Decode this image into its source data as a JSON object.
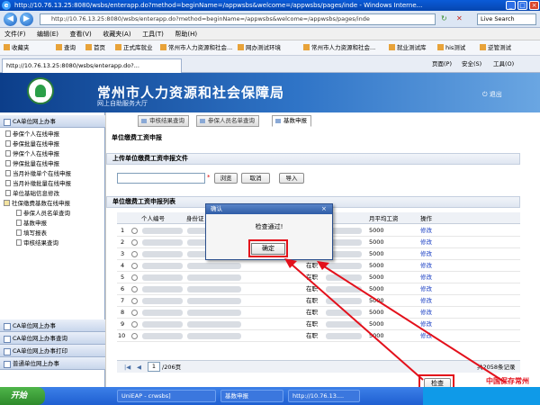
{
  "browser": {
    "title": "http://10.76.13.25:8080/wsbs/enterapp.do?method=beginName=/appwsbs&welcome=/appwsbs/pages/inde - Windows Interne...",
    "address": "http://10.76.13.25:8080/wsbs/enterapp.do?method=beginName=/appwsbs&welcome=/appwsbs/pages/inde",
    "search_placeholder": "Live Search",
    "menu": [
      "文件(F)",
      "编辑(E)",
      "查看(V)",
      "收藏夹(A)",
      "工具(T)",
      "帮助(H)"
    ],
    "favorites_label": "收藏夹",
    "favorites": [
      "查询",
      "首页",
      "正式库就业",
      "常州市人力资源和社会...",
      "网办测试环境",
      "常州市人力资源和社会...",
      "就业测试库",
      "his测试",
      "逆管测试"
    ],
    "tab_label": "http://10.76.13.25:8080/wsbs/enterapp.do?...",
    "toolbar": [
      "页面(P)",
      "安全(S)",
      "工具(O)"
    ]
  },
  "site": {
    "title": "常州市人力资源和社会保障局",
    "subtitle": "网上自助服务大厅",
    "exit_label": "退出"
  },
  "left": {
    "top_header": "CA单位网上办事",
    "tree": [
      "参保个人在线申报",
      "参保批量在线申报",
      "停保个人在线申报",
      "停保批量在线申报",
      "当月补缴单个在线申报",
      "当月补缴批量在线申报",
      "单位基础信息修改",
      "社保缴费基数在线申报"
    ],
    "sub_tree": [
      "参保人员名单查询",
      "基数申报",
      "填写报表",
      "审核结果查询"
    ],
    "bottom_headers": [
      "CA单位网上办事",
      "CA单位网上办事查询",
      "CA单位网上办事打印",
      "普通单位网上办事"
    ]
  },
  "content": {
    "tabs": [
      "审核结果查询",
      "参保人员名单查询",
      "基数申报"
    ],
    "page_heading": "单位缴费工资申报",
    "upload_heading": "上传单位缴费工资申报文件",
    "browse_label": "浏览",
    "cancel_label": "取消",
    "import_label": "导入",
    "list_heading": "单位缴费工资申报列表",
    "columns": [
      "个人编号",
      "身份证",
      "月平均工资",
      "操作"
    ],
    "rows": [
      {
        "no": "1",
        "wage": "5000",
        "status": "",
        "action": "修改"
      },
      {
        "no": "2",
        "wage": "5000",
        "status": "",
        "action": "修改"
      },
      {
        "no": "3",
        "wage": "5000",
        "status": "",
        "action": "修改"
      },
      {
        "no": "4",
        "wage": "5000",
        "status": "在职",
        "action": "修改"
      },
      {
        "no": "5",
        "wage": "5000",
        "status": "在职",
        "action": "修改"
      },
      {
        "no": "6",
        "wage": "5000",
        "status": "在职",
        "action": "修改"
      },
      {
        "no": "7",
        "wage": "5000",
        "status": "在职",
        "action": "修改"
      },
      {
        "no": "8",
        "wage": "5000",
        "status": "在职",
        "action": "修改"
      },
      {
        "no": "9",
        "wage": "5000",
        "status": "在职",
        "action": "修改"
      },
      {
        "no": "10",
        "wage": "5000",
        "status": "在职",
        "action": "修改"
      }
    ],
    "pager_page": "1",
    "pager_total": "/206页",
    "pager_records": "共2058条记录",
    "check_label": "检查"
  },
  "dialog": {
    "title": "确认",
    "message": "检查通过!",
    "ok_label": "确定"
  },
  "taskbar": {
    "start": "开始",
    "tasks": [
      "UniEAP - crwsbs]",
      "基数申报",
      "http://10.76.13...."
    ],
    "watermark": "中国保存常州"
  }
}
